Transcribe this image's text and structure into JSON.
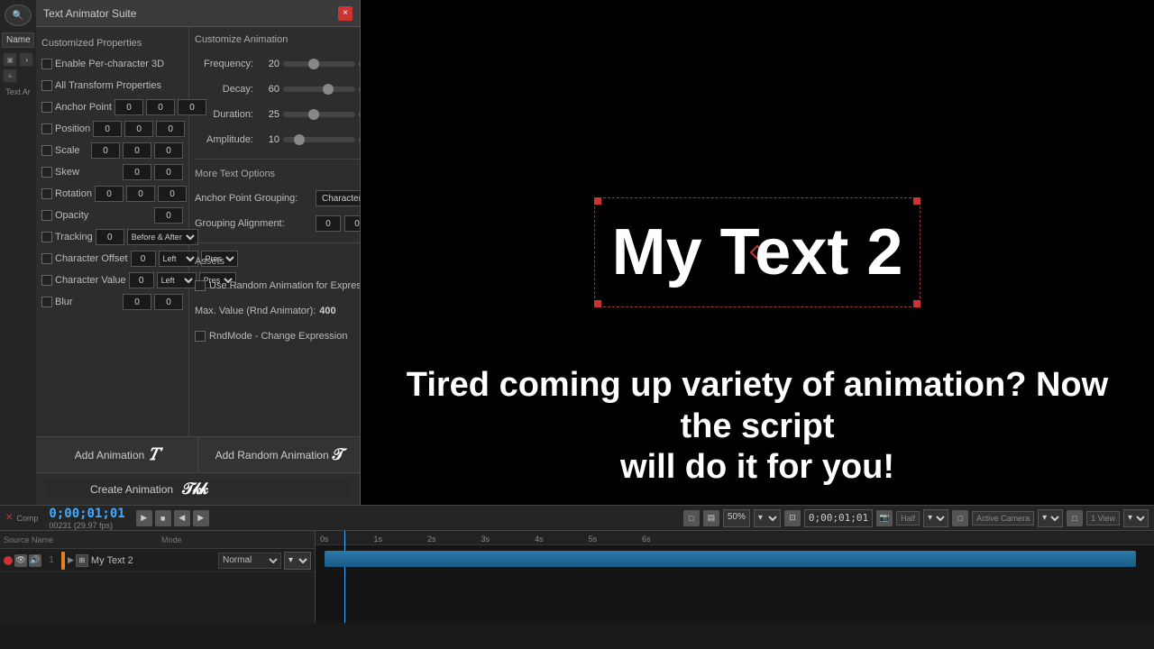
{
  "window": {
    "title": "Text Animator Suite",
    "close_btn": "×"
  },
  "left_panel": {
    "customized_label": "Customized Properties",
    "enable_per_char": "Enable Per-character 3D",
    "all_transform": "All Transform Properties",
    "properties": [
      {
        "id": "anchor_point",
        "label": "Anchor Point",
        "values": [
          "0",
          "0",
          "0"
        ]
      },
      {
        "id": "position",
        "label": "Position",
        "values": [
          "0",
          "0",
          "0"
        ]
      },
      {
        "id": "scale",
        "label": "Scale",
        "values": [
          "0",
          "0",
          "0"
        ]
      },
      {
        "id": "skew",
        "label": "Skew",
        "values": [
          "0",
          "0"
        ]
      },
      {
        "id": "rotation",
        "label": "Rotation",
        "values": [
          "0",
          "0",
          "0"
        ]
      },
      {
        "id": "opacity",
        "label": "Opacity",
        "values": [
          "0"
        ]
      },
      {
        "id": "tracking",
        "label": "Tracking",
        "values": [
          "0"
        ],
        "dropdown": "Before & After"
      },
      {
        "id": "char_offset",
        "label": "Character Offset",
        "values": [
          "0"
        ],
        "dropdown1": "Left",
        "dropdown2": "Pres"
      },
      {
        "id": "char_value",
        "label": "Character Value",
        "values": [
          "0"
        ],
        "dropdown1": "Left",
        "dropdown2": "Pres"
      },
      {
        "id": "blur",
        "label": "Blur",
        "values": [
          "0",
          "0"
        ]
      }
    ]
  },
  "right_panel": {
    "customize_label": "Customize Animation",
    "sliders": [
      {
        "id": "frequency",
        "label": "Frequency:",
        "value": "20",
        "pct": 35
      },
      {
        "id": "decay",
        "label": "Decay:",
        "value": "60",
        "pct": 55
      },
      {
        "id": "duration",
        "label": "Duration:",
        "value": "25",
        "pct": 35
      },
      {
        "id": "amplitude",
        "label": "Amplitude:",
        "value": "10",
        "pct": 15
      }
    ],
    "more_text_label": "More Text Options",
    "anchor_grouping_label": "Anchor Point Grouping:",
    "anchor_grouping_value": "Character",
    "grouping_align_label": "Grouping Alignment:",
    "grouping_align_x": "0",
    "grouping_align_y": "0",
    "assets_label": "Assets",
    "use_random_label": "Use Random Animation for Expression",
    "max_value_label": "Max. Value (Rnd Animator):",
    "max_value": "400",
    "rnd_mode_label": "RndMode - Change Expression"
  },
  "buttons": {
    "add_animation": "Add Animation",
    "add_random": "Add Random Animation",
    "create_animation": "Create Animation"
  },
  "preview": {
    "text": "My Text 2"
  },
  "subtitle": {
    "line1": "Tired coming up variety of animation? Now the script",
    "line2": "will do it for you!"
  },
  "timeline": {
    "timecode": "0;00;01;01",
    "fps_info": "00231 (29.97 fps)",
    "zoom": "50%",
    "half": "Half",
    "camera": "Active Camera",
    "view": "1 View",
    "ruler_marks": [
      "",
      "0s",
      "1s",
      "2s",
      "3s",
      "4s",
      "5s",
      "6s"
    ],
    "layers": [
      {
        "number": "1",
        "name": "My Text 2",
        "mode": "Normal"
      }
    ],
    "col_headers": [
      "Source Name",
      "Mode"
    ]
  }
}
